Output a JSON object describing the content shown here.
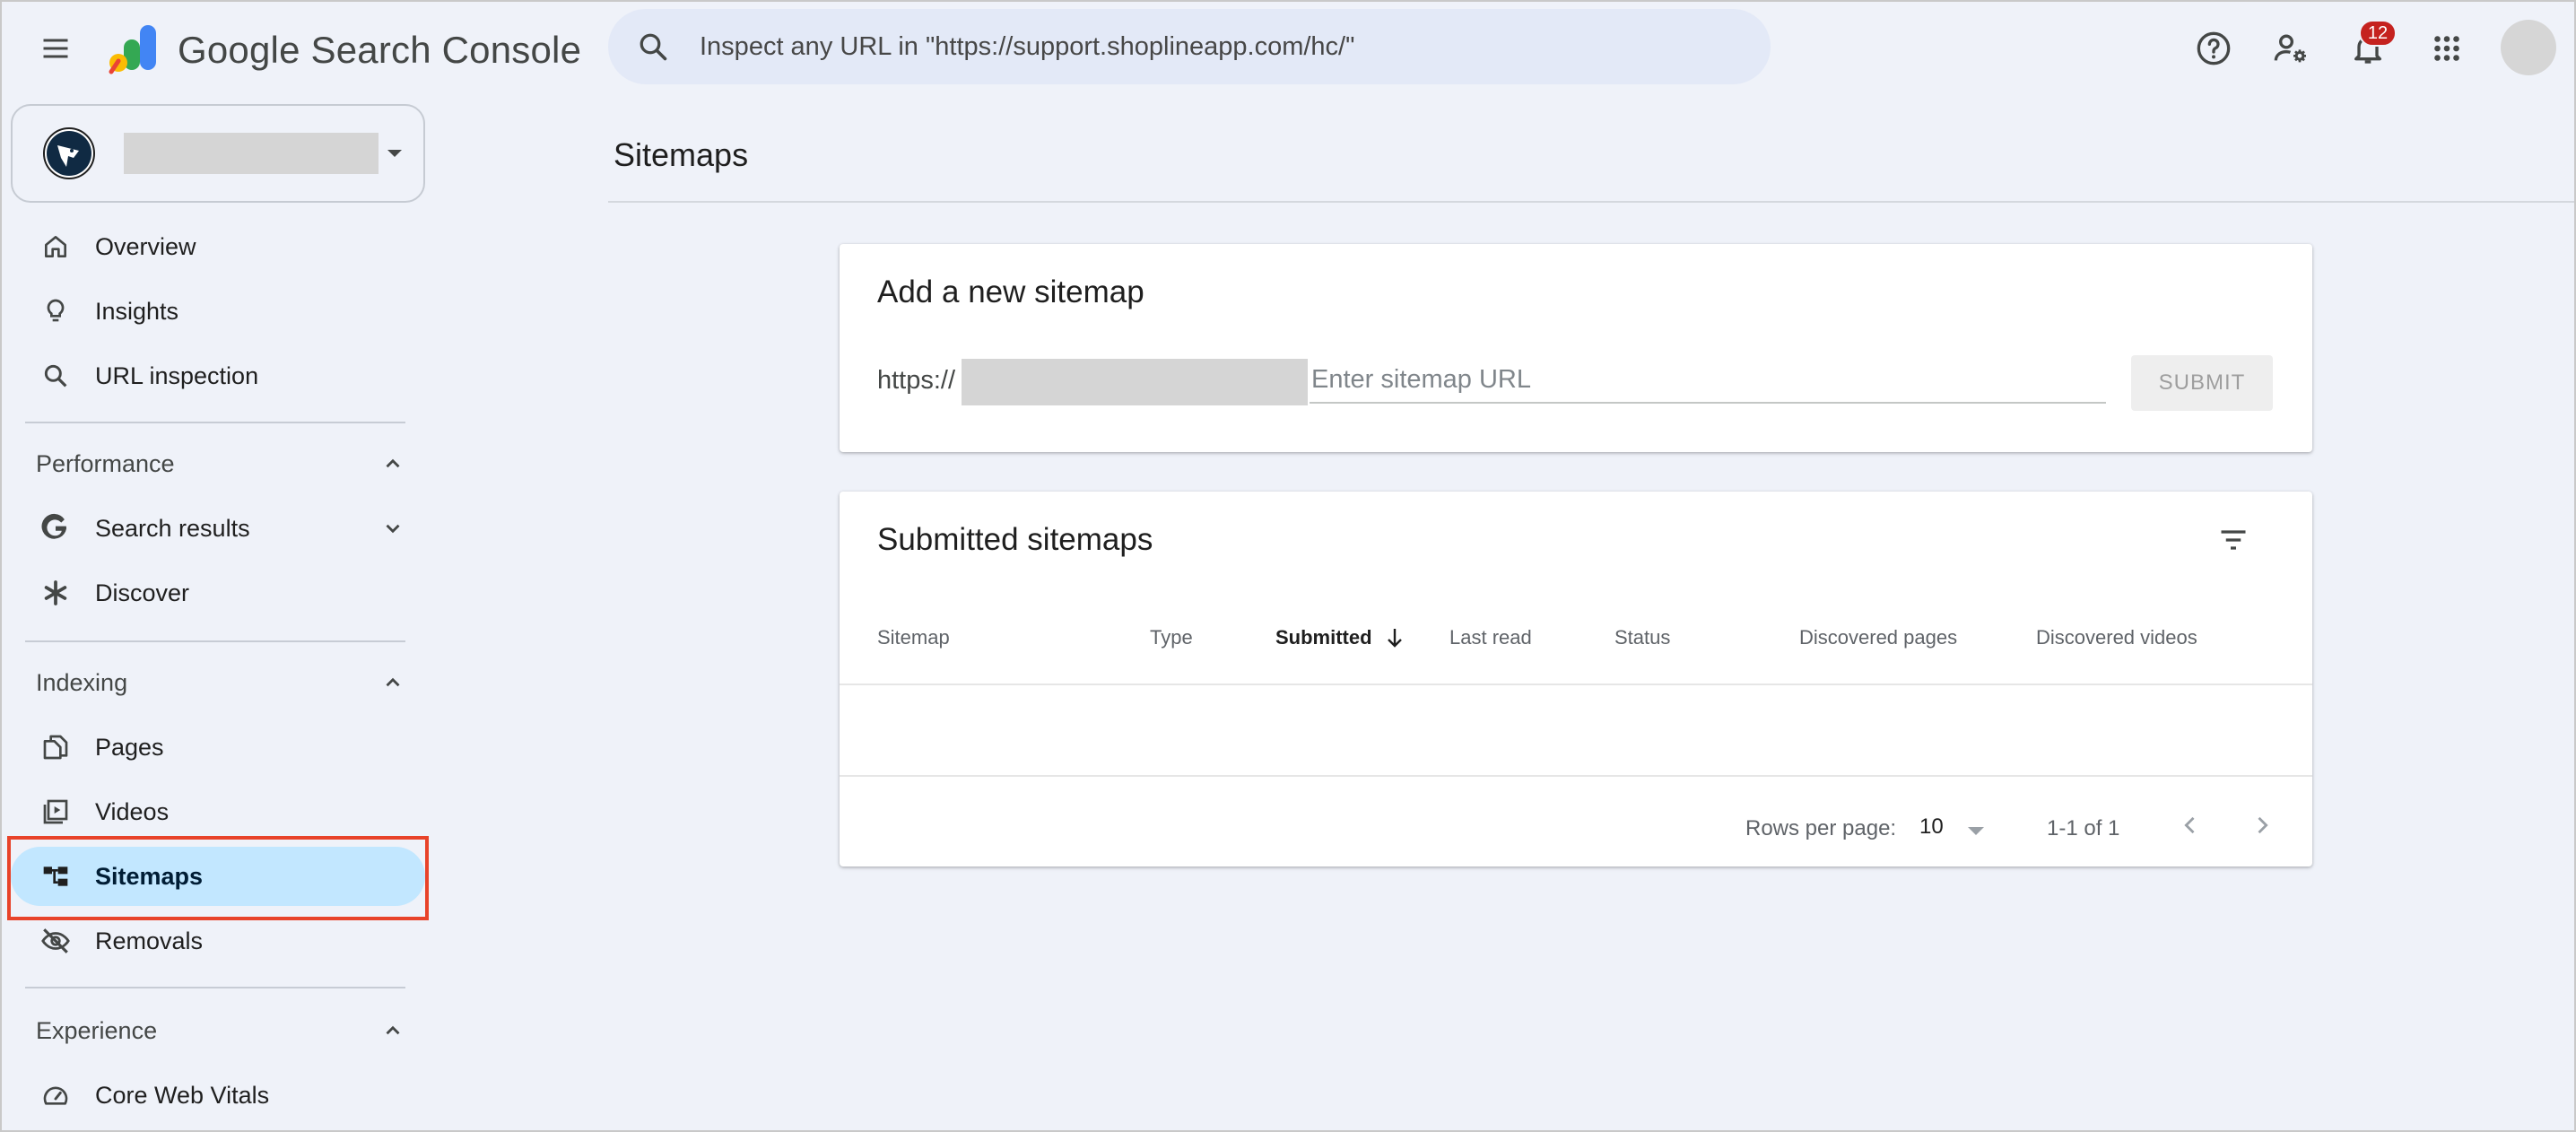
{
  "app": {
    "title": "Google Search Console"
  },
  "search": {
    "placeholder": "Inspect any URL in \"https://support.shoplineapp.com/hc/\""
  },
  "header": {
    "notifications_count": "12"
  },
  "sidebar": {
    "items_top": [
      {
        "label": "Overview",
        "icon": "home-icon"
      },
      {
        "label": "Insights",
        "icon": "lightbulb-icon"
      },
      {
        "label": "URL inspection",
        "icon": "search-icon"
      }
    ],
    "performance": {
      "label": "Performance",
      "items": [
        {
          "label": "Search results",
          "icon": "google-g-icon"
        },
        {
          "label": "Discover",
          "icon": "asterisk-icon"
        }
      ]
    },
    "indexing": {
      "label": "Indexing",
      "items": [
        {
          "label": "Pages",
          "icon": "pages-icon"
        },
        {
          "label": "Videos",
          "icon": "video-library-icon"
        },
        {
          "label": "Sitemaps",
          "icon": "sitemap-icon",
          "active": true
        },
        {
          "label": "Removals",
          "icon": "eye-off-icon"
        }
      ]
    },
    "experience": {
      "label": "Experience",
      "items": [
        {
          "label": "Core Web Vitals",
          "icon": "speedometer-icon"
        }
      ]
    }
  },
  "main": {
    "page_title": "Sitemaps",
    "add_sitemap": {
      "title": "Add a new sitemap",
      "prefix": "https://",
      "placeholder": "Enter sitemap URL",
      "submit_label": "SUBMIT"
    },
    "submitted": {
      "title": "Submitted sitemaps",
      "columns": [
        "Sitemap",
        "Type",
        "Submitted",
        "Last read",
        "Status",
        "Discovered pages",
        "Discovered videos"
      ],
      "sorted_column": "Submitted",
      "rows": [],
      "pagination": {
        "rows_per_page_label": "Rows per page:",
        "rows_per_page": "10",
        "range": "1-1 of 1"
      }
    }
  },
  "colors": {
    "accent_active": "#c2e7ff",
    "highlight_border": "#e8432a",
    "background": "#eff2f9",
    "badge": "#c5221f"
  }
}
